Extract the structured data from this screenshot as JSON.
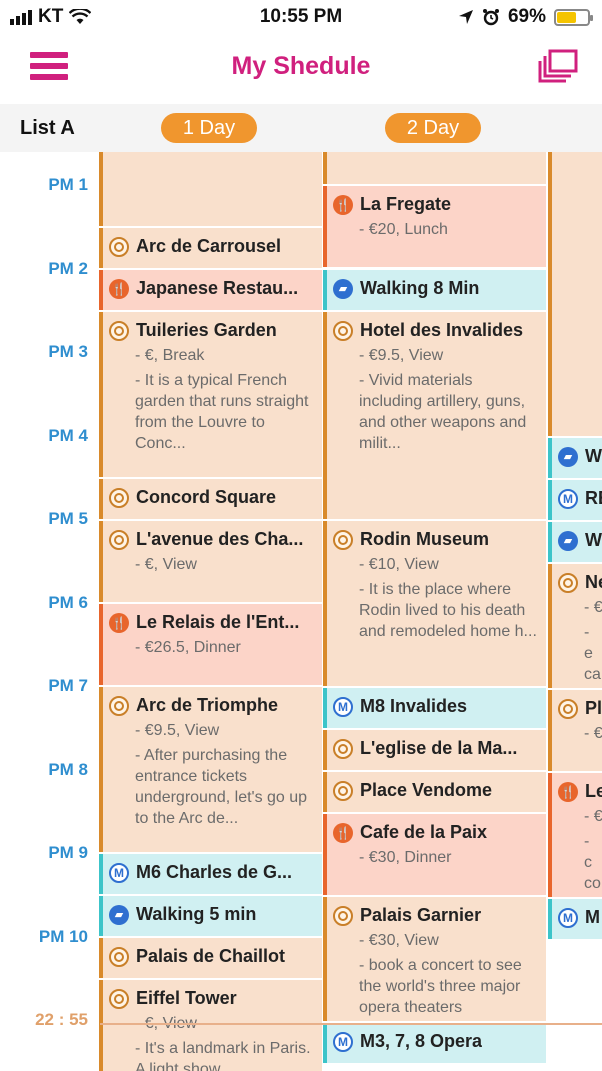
{
  "status": {
    "carrier": "KT",
    "time": "10:55 PM",
    "battery_percent": "69%",
    "battery_level": 0.69
  },
  "nav": {
    "title": "My Shedule",
    "menu_icon": "hamburger-menu-icon",
    "copy_icon": "copy-layers-icon"
  },
  "tabs": {
    "list_label": "List A",
    "days": [
      "1 Day",
      "2 Day"
    ]
  },
  "hours": [
    "PM 1",
    "PM 2",
    "PM 3",
    "PM 4",
    "PM 5",
    "PM 6",
    "PM 7",
    "PM 8",
    "PM 9",
    "PM 10"
  ],
  "now_label": "22 : 55",
  "colors": {
    "accent": "#d0207e",
    "day_pill": "#f0962e",
    "hour_label": "#2f8ecf",
    "sight_bg": "#f9e0cc",
    "food_bg": "#fcd4c8",
    "move_bg": "#d0f0f2"
  },
  "day1": [
    {
      "title": "Arc de Carrousel"
    },
    {
      "title": "Japanese Restau..."
    },
    {
      "title": "Tuileries Garden",
      "sub": "- €, Break",
      "desc": "- It is a typical French garden that runs straight from the Louvre to Conc..."
    },
    {
      "title": "Concord Square"
    },
    {
      "title": "L'avenue des Cha...",
      "sub": "- €, View"
    },
    {
      "title": "Le Relais de l'Ent...",
      "sub": "- €26.5, Dinner"
    },
    {
      "title": "Arc de Triomphe",
      "sub": "- €9.5, View",
      "desc": "- After purchasing the entrance tickets underground, let's go up to the Arc de..."
    },
    {
      "title": "M6 Charles de G..."
    },
    {
      "title": "Walking 5 min"
    },
    {
      "title": "Palais de Chaillot"
    },
    {
      "title": "Eiffel Tower",
      "sub": "- €, View",
      "desc": "- It's a landmark in Paris. A light show"
    }
  ],
  "day2": [
    {
      "title": "La Fregate",
      "sub": "- €20, Lunch"
    },
    {
      "title": "Walking 8 Min"
    },
    {
      "title": "Hotel des Invalides",
      "sub": "- €9.5, View",
      "desc": "- Vivid materials including artillery, guns, and other weapons and milit..."
    },
    {
      "title": "Rodin Museum",
      "sub": "- €10, View",
      "desc": "- It is the place where Rodin lived to his death and remodeled home h..."
    },
    {
      "title": "M8 Invalides"
    },
    {
      "title": "L'eglise de la Ma..."
    },
    {
      "title": "Place Vendome"
    },
    {
      "title": "Cafe de la Paix",
      "sub": "- €30, Dinner"
    },
    {
      "title": "Palais Garnier",
      "sub": "- €30, View",
      "desc": "- book a concert to see the world's three major opera theaters"
    },
    {
      "title": "M3, 7, 8 Opera"
    }
  ],
  "day3": [
    {
      "title": "W"
    },
    {
      "title": "RE"
    },
    {
      "title": "W"
    },
    {
      "title": "Ne",
      "sub": "- €",
      "desc": "- e ca en to"
    },
    {
      "title": "Pl",
      "sub": "- €"
    },
    {
      "title": "Le",
      "sub": "- €",
      "desc": "- c co"
    },
    {
      "title": "M"
    }
  ]
}
